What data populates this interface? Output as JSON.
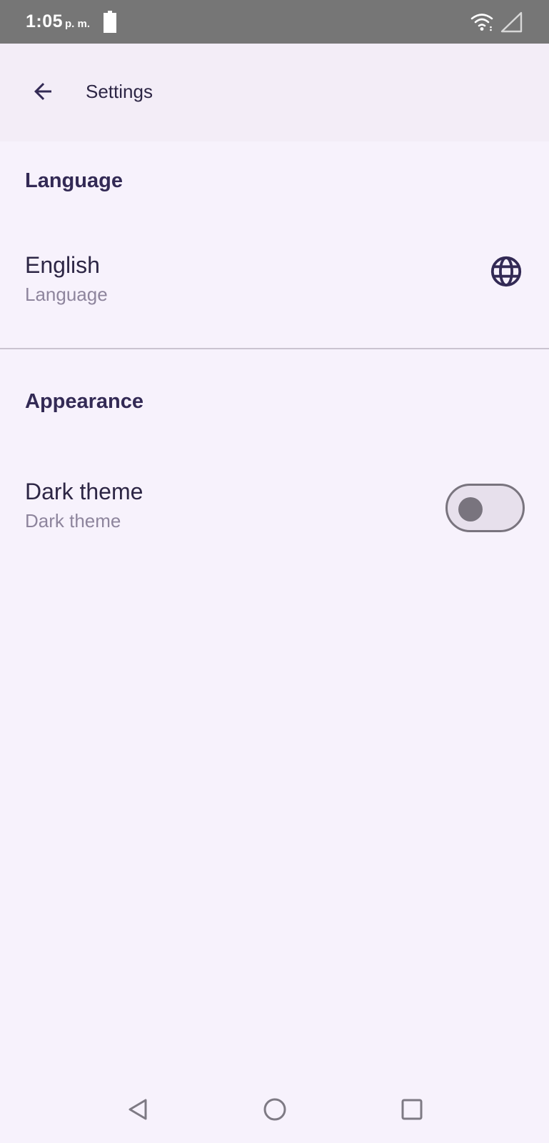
{
  "status_bar": {
    "time": "1:05",
    "ampm": "p. m.",
    "icons": [
      "battery-icon",
      "wifi-icon",
      "cell-signal-icon"
    ]
  },
  "top_bar": {
    "title": "Settings",
    "back_icon": "arrow-back-icon"
  },
  "sections": [
    {
      "title": "Language",
      "items": [
        {
          "title": "English",
          "summary": "Language",
          "icon": "globe-icon"
        }
      ]
    },
    {
      "title": "Appearance",
      "items": [
        {
          "title": "Dark theme",
          "summary": "Dark theme",
          "toggle": false
        }
      ]
    }
  ],
  "nav_bar": {
    "buttons": [
      "nav-back-icon",
      "nav-home-icon",
      "nav-recents-icon"
    ]
  },
  "colors": {
    "background": "#f7f2fc",
    "top_bar": "#f3edf7",
    "status_bar": "#767676",
    "primary_text": "#2d2645",
    "secondary_text": "#8e859d",
    "accent": "#332a55"
  }
}
